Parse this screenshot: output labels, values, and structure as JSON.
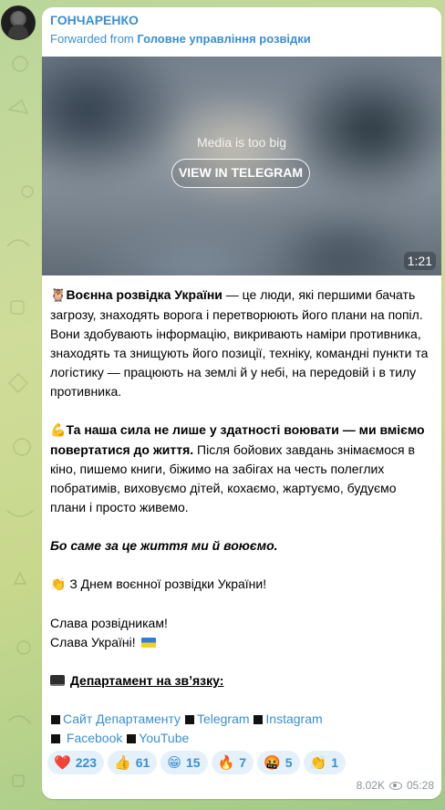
{
  "channel": {
    "name": "ГОНЧАРЕНКО",
    "forwarded_prefix": "Forwarded from",
    "forwarded_source": "Головне управління розвідки"
  },
  "media": {
    "notice": "Media is too big",
    "button_label": "VIEW IN TELEGRAM",
    "duration": "1:21"
  },
  "message": {
    "p1_emoji": "🦉",
    "p1_bold": "Воєнна розвідка України",
    "p1_rest": " — це люди, які першими бачать загрозу, знаходять ворога і перетворюють його плани на попіл. Вони здобувають інформацію, викривають наміри противника, знаходять та знищують його позиції, техніку, командні пункти та логістику — працюють на землі й у небі, на передовій і в тилу противника.",
    "p2_emoji": "💪",
    "p2_bold": "Та наша сила не лише у здатності воювати — ми вміємо повертатися до життя.",
    "p2_rest": " Після бойових завдань знімаємося в кіно, пишемо книги, біжимо на забігах на честь полеглих побратимів, виховуємо дітей, кохаємо, жартуємо, будуємо плани і просто живемо.",
    "p3_italic": "Бо саме за це життя ми й воюємо.",
    "p4_emoji": "👏",
    "p4_text": "З Днем воєнної розвідки України!",
    "p5_line1": "Слава розвідникам!",
    "p5_line2": "Слава Україні!",
    "p6_heading": "Департамент на звʼязку:",
    "links": {
      "site": "Сайт Департаменту",
      "telegram": "Telegram",
      "instagram": "Instagram",
      "facebook": "Facebook",
      "youtube": "YouTube"
    }
  },
  "reactions": [
    {
      "emoji": "❤️",
      "count": "223"
    },
    {
      "emoji": "👍",
      "count": "61"
    },
    {
      "emoji": "😁",
      "count": "15"
    },
    {
      "emoji": "🔥",
      "count": "7"
    },
    {
      "emoji": "🤬",
      "count": "5"
    },
    {
      "emoji": "👏",
      "count": "1"
    }
  ],
  "meta": {
    "views": "8.02K",
    "time": "05:28"
  },
  "colors": {
    "accent": "#3a8fd3",
    "bubble": "#ffffff",
    "reaction_bg": "#e4f1fb"
  }
}
